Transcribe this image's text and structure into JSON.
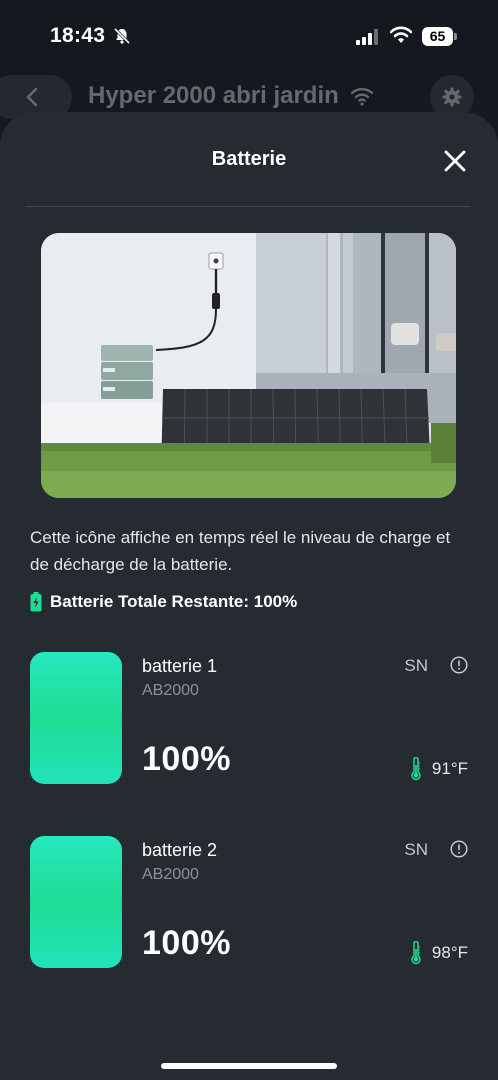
{
  "status_bar": {
    "time": "18:43",
    "battery_level": "65",
    "icons": [
      "bell-slash-icon",
      "cellular-signal-icon",
      "wifi-icon",
      "battery-icon"
    ]
  },
  "header": {
    "title": "Hyper 2000 abri jardin",
    "icons": [
      "chevron-left-icon",
      "wifi-icon",
      "gear-icon"
    ]
  },
  "sheet": {
    "title": "Batterie",
    "description": "Cette icône affiche en temps réel le niveau de charge et de décharge de la batterie.",
    "total_label": "Batterie Totale Restante: 100%"
  },
  "batteries": [
    {
      "name": "batterie 1",
      "model": "AB2000",
      "percent": "100%",
      "sn_label": "SN",
      "temperature": "91°F",
      "charge_fraction": 1.0
    },
    {
      "name": "batterie 2",
      "model": "AB2000",
      "percent": "100%",
      "sn_label": "SN",
      "temperature": "98°F",
      "charge_fraction": 1.0
    }
  ],
  "colors": {
    "accent": "#1fdc93",
    "sheet_background": "#262a31",
    "page_background": "#15181e"
  }
}
